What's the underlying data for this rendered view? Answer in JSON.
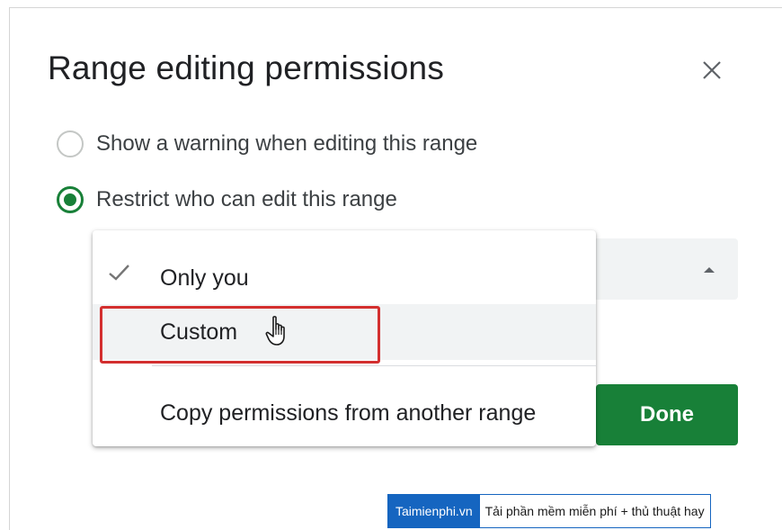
{
  "dialog": {
    "title": "Range editing permissions",
    "close_icon": "close-icon"
  },
  "options": [
    {
      "label": "Show a warning when editing this range",
      "selected": false
    },
    {
      "label": "Restrict who can edit this range",
      "selected": true
    }
  ],
  "menu": {
    "items": [
      {
        "label": "Only you",
        "checked": true,
        "icon": "check-icon"
      },
      {
        "label": "Custom",
        "highlighted": true,
        "hovered": true
      },
      {
        "label": "Copy permissions from another range"
      }
    ],
    "cursor_icon": "hand-pointer-icon",
    "highlight_color": "#d32f2f"
  },
  "buttons": {
    "done_label": "Done"
  },
  "watermark": {
    "brand": "Taimienphi.vn",
    "tagline": "Tải phần mềm miễn phí + thủ thuật hay"
  },
  "colors": {
    "accent_green": "#188038",
    "watermark_blue": "#1565c0"
  }
}
